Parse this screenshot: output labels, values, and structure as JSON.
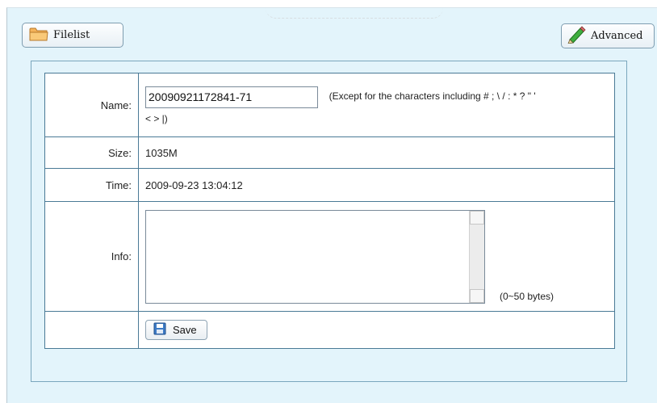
{
  "toolbar": {
    "filelist_label": "Filelist",
    "advanced_label": "Advanced"
  },
  "form": {
    "name_label": "Name:",
    "name_value": "20090921172841-71",
    "name_hint_line1": "(Except for the characters including # ; \\ / : * ? \" '",
    "name_hint_line2": "< > |)",
    "size_label": "Size:",
    "size_value": "1035M",
    "time_label": "Time:",
    "time_value": "2009-09-23 13:04:12",
    "info_label": "Info:",
    "info_value": "",
    "info_hint": "(0~50 bytes)",
    "save_label": "Save"
  },
  "icons": {
    "filelist": "folder-icon",
    "advanced": "pencil-icon",
    "save": "floppy-disk-icon"
  }
}
